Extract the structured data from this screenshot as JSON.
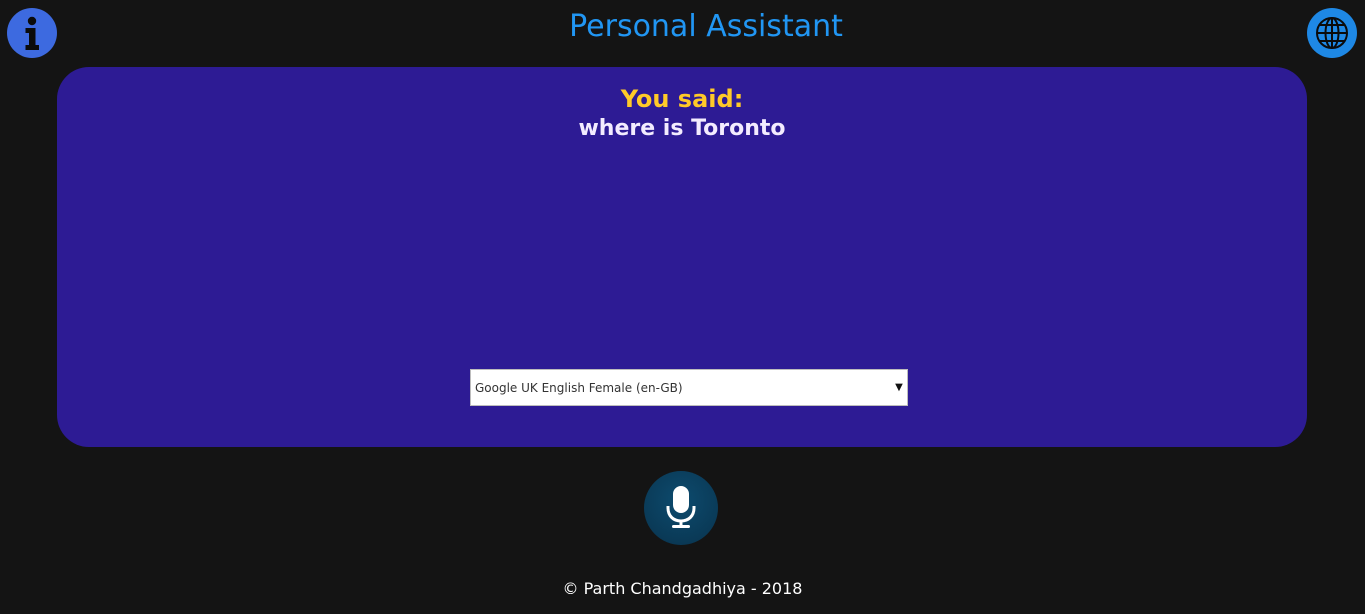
{
  "header": {
    "title": "Personal Assistant",
    "info_icon": "info-icon",
    "language_icon": "globe-icon"
  },
  "conversation": {
    "label": "You said:",
    "transcript": "where is Toronto"
  },
  "voice_select": {
    "selected": "Google UK English Female (en-GB)"
  },
  "mic": {
    "icon": "microphone-icon"
  },
  "footer": {
    "copyright": "© Parth Chandgadhiya - 2018"
  },
  "colors": {
    "background": "#141414",
    "panel": "#2d1b94",
    "title": "#2196f3",
    "label": "#ffca28",
    "info_button": "#3d6ae0",
    "globe_button": "#1e88e5",
    "mic_button": "#0a3a57"
  }
}
